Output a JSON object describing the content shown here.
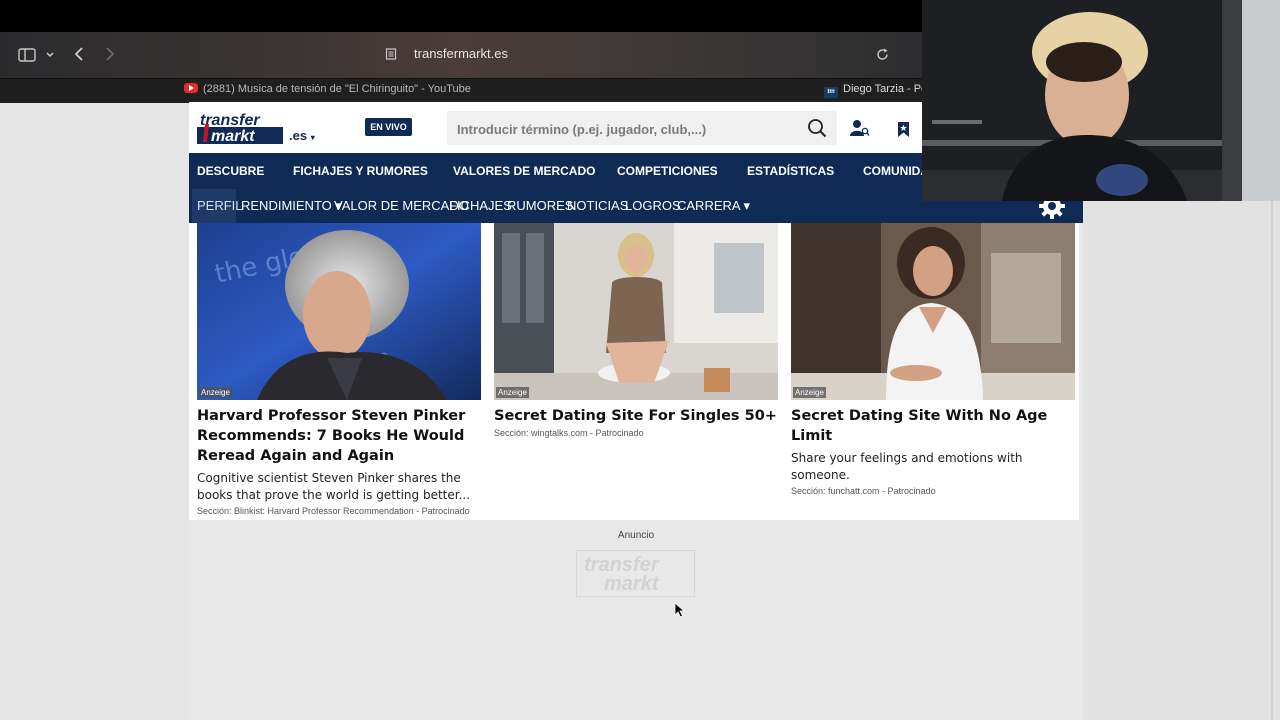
{
  "browser": {
    "url": "transfermarkt.es",
    "tabs": [
      {
        "label": "(2881) Musica de tensión de \"El Chiringuito\" - YouTube"
      },
      {
        "label": "Diego Tarzia - Per"
      }
    ]
  },
  "header": {
    "logo_top": "transfer",
    "logo_bottom": "markt",
    "domain_suffix": ".es",
    "live_badge": "EN VIVO",
    "search_placeholder": "Introducir término (p.ej. jugador, club,...)"
  },
  "main_nav": {
    "items": [
      {
        "label": "DESCUBRE"
      },
      {
        "label": "FICHAJES Y RUMORES"
      },
      {
        "label": "VALORES DE MERCADO"
      },
      {
        "label": "COMPETICIONES"
      },
      {
        "label": "ESTADÍSTICAS"
      },
      {
        "label": "COMUNIDA"
      }
    ]
  },
  "sub_nav": {
    "items": [
      {
        "label": "PERFIL"
      },
      {
        "label": "RENDIMIENTO ▾"
      },
      {
        "label": "VALOR DE MERCADO"
      },
      {
        "label": "FICHAJES"
      },
      {
        "label": "RUMORES"
      },
      {
        "label": "NOTICIAS"
      },
      {
        "label": "LOGROS"
      },
      {
        "label": "CARRERA ▾"
      }
    ]
  },
  "ads": [
    {
      "tag": "Anzeige",
      "title": "Harvard Professor Steven Pinker Recommends: 7 Books He Would Reread Again and Again",
      "description": "Cognitive scientist Steven Pinker shares the books that prove the world is getting better...",
      "source": "Sección: Blinkist: Harvard Professor Recommendation - Patrocinado"
    },
    {
      "tag": "Anzeige",
      "title": "Secret Dating Site For Singles 50+",
      "description": "",
      "source": "Sección: wingtalks.com - Patrocinado"
    },
    {
      "tag": "Anzeige",
      "title": "Secret Dating Site With No Age Limit",
      "description": "Share your feelings and emotions with someone.",
      "source": "Sección: funchatt.com - Patrocinado"
    }
  ],
  "ad_label": "Anuncio",
  "colors": {
    "nav_bg": "#0f2a55",
    "page_bg": "#e8e8e8",
    "badge_bg": "#0f2a55"
  }
}
